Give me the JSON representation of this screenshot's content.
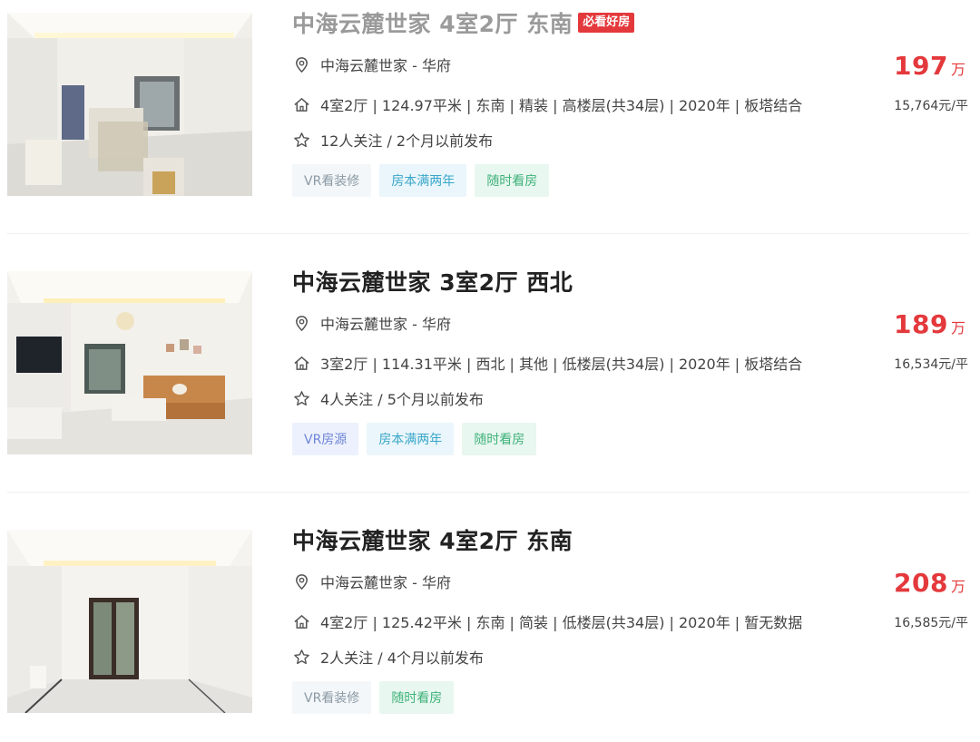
{
  "listings": [
    {
      "title": "中海云麓世家 4室2厅 东南",
      "badge": "必看好房",
      "community": "中海云麓世家 - 华府",
      "info": "4室2厅 | 124.97平米 | 东南 | 精装 | 高楼层(共34层) | 2020年 | 板塔结合",
      "follow": "12人关注 / 2个月以前发布",
      "tags": [
        "VR看装修",
        "房本满两年",
        "随时看房"
      ],
      "price": "197",
      "price_unit": "万",
      "unit_price": "15,764元/平"
    },
    {
      "title": "中海云麓世家 3室2厅 西北",
      "community": "中海云麓世家 - 华府",
      "info": "3室2厅 | 114.31平米 | 西北 | 其他 | 低楼层(共34层) | 2020年 | 板塔结合",
      "follow": "4人关注 / 5个月以前发布",
      "tags": [
        "VR房源",
        "房本满两年",
        "随时看房"
      ],
      "price": "189",
      "price_unit": "万",
      "unit_price": "16,534元/平"
    },
    {
      "title": "中海云麓世家 4室2厅 东南",
      "community": "中海云麓世家 - 华府",
      "info": "4室2厅 | 125.42平米 | 东南 | 简装 | 低楼层(共34层) | 2020年 | 暂无数据",
      "follow": "2人关注 / 4个月以前发布",
      "tags": [
        "VR看装修",
        "随时看房"
      ],
      "price": "208",
      "price_unit": "万",
      "unit_price": "16,585元/平"
    }
  ],
  "colors": {
    "price_red": "#e4393c",
    "badge_red": "#e4393c",
    "tag_vr_decor": "#8a9aa5",
    "tag_vr_source": "#6e86d6",
    "tag_two_years": "#3aa7c9",
    "tag_anytime": "#3fb27a"
  },
  "icons": {
    "community": "location-pin-icon",
    "info": "house-icon",
    "follow": "star-icon"
  }
}
